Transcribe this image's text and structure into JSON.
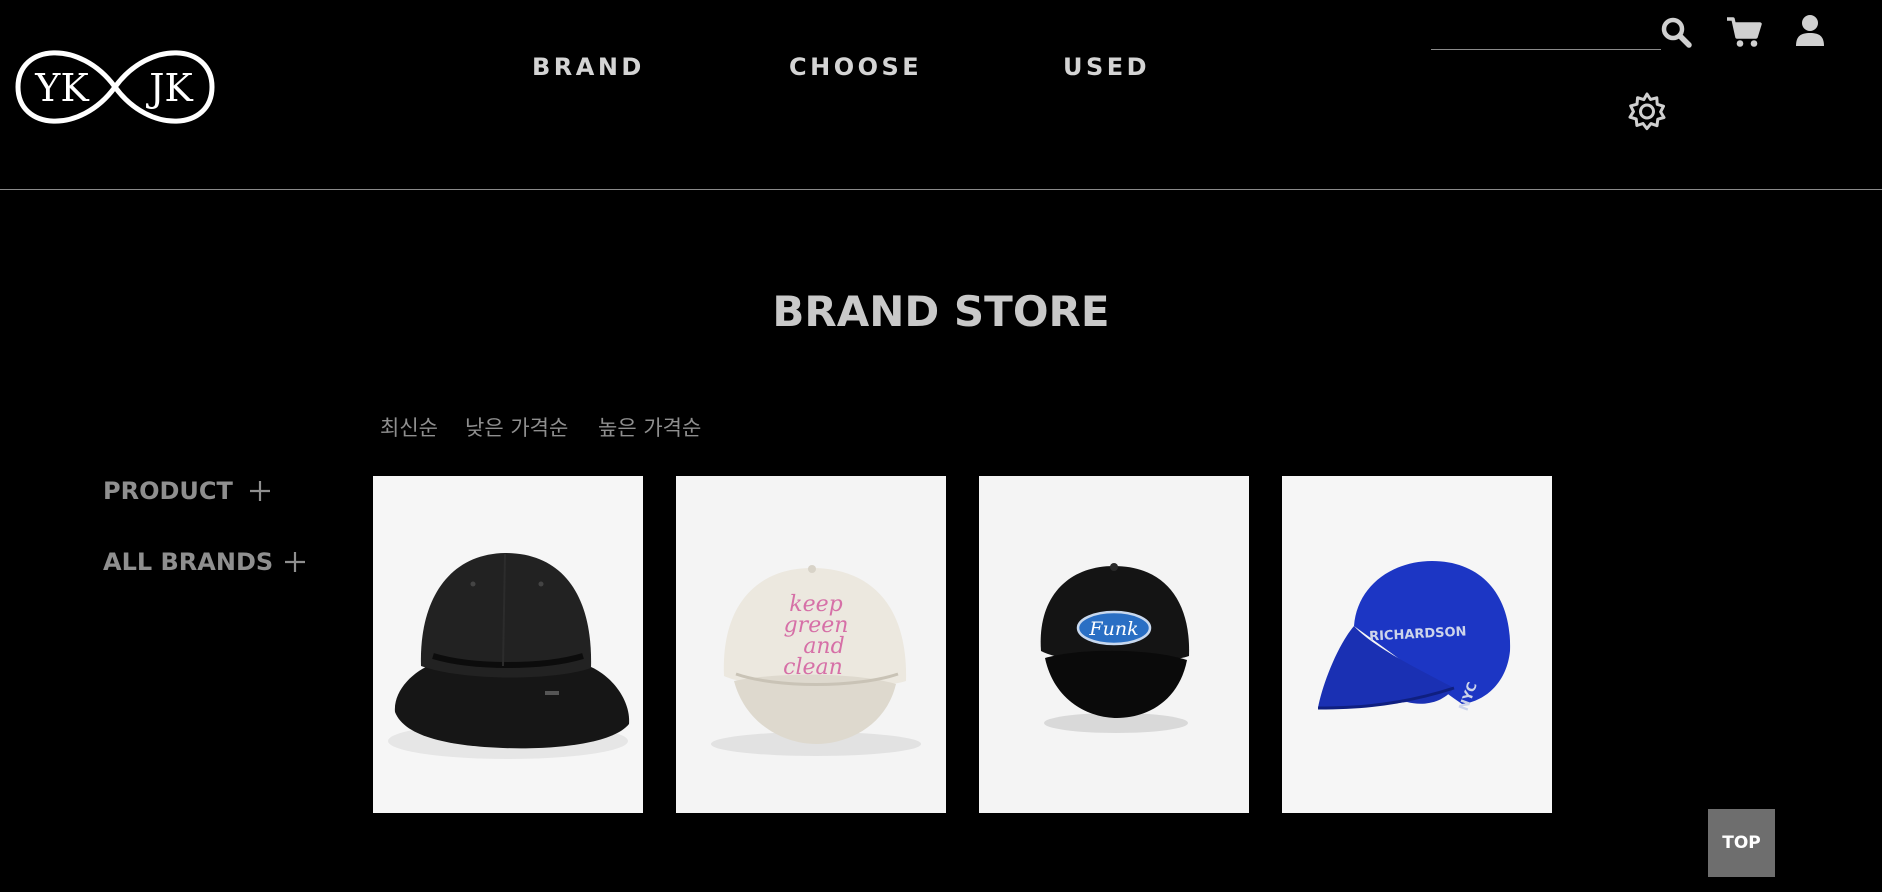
{
  "logo": {
    "left_text": "YK",
    "right_text": "JK"
  },
  "nav": {
    "items": [
      "BRAND",
      "CHOOSE",
      "USED"
    ]
  },
  "header": {
    "search": {
      "value": "",
      "placeholder": ""
    },
    "icons": [
      "search-icon",
      "cart-icon",
      "user-icon",
      "gear-icon"
    ]
  },
  "main": {
    "title": "BRAND STORE",
    "sort_options": [
      "최신순",
      "낮은 가격순",
      "높은 가격순"
    ],
    "filters": [
      {
        "label": "PRODUCT",
        "icon": "plus-icon"
      },
      {
        "label": "ALL BRANDS",
        "icon": "plus-icon"
      }
    ],
    "products": [
      {
        "image": "black bucket hat",
        "color": "#1b1b1b"
      },
      {
        "image": "cream cap with pink embroidery",
        "embroidery": [
          "keep",
          "green",
          "and",
          "clean"
        ],
        "color": "#ece8df"
      },
      {
        "image": "black cap with blue oval patch",
        "patch_text": "Funk",
        "color": "#141414"
      },
      {
        "image": "royal blue cap",
        "front_text": "RICHARDSON",
        "side_text": "NYC",
        "color": "#1c36c4"
      }
    ]
  },
  "top_button": {
    "label": "TOP"
  },
  "colors": {
    "background": "#000000",
    "nav_text": "#d4d4d4",
    "muted_text": "#8f8f8f",
    "top_button_bg": "#6e6e6e"
  }
}
